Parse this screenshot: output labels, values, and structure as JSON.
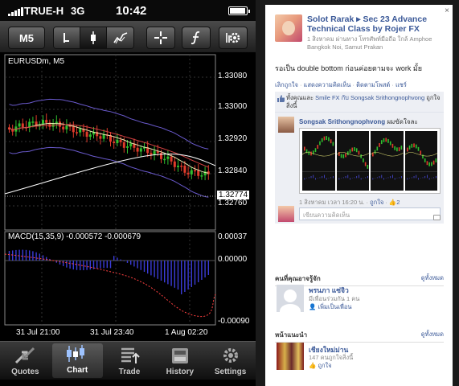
{
  "status_bar": {
    "carrier": "TRUE-H",
    "network": "3G",
    "time": "10:42"
  },
  "toolbar": {
    "timeframe": "M5",
    "buttons": [
      "line-chart",
      "candle-chart",
      "bar-chart",
      "crosshair",
      "indicators",
      "settings"
    ]
  },
  "chart": {
    "symbol_label": "EURUSDm, M5",
    "price_ticks": [
      "1.33080",
      "1.33000",
      "1.32920",
      "1.32840",
      "1.32760"
    ],
    "current_price": "1.32774",
    "macd_label": "MACD(15,35,9) -0.000572 -0.000679",
    "macd_ticks": [
      "0.00037",
      "0.00000",
      "-0.00090"
    ],
    "time_labels": [
      "31 Jul 21:00",
      "31 Jul 23:40",
      "1 Aug 02:20"
    ],
    "colors": {
      "bull": "#2fbf2f",
      "bear": "#e03b2b",
      "bollinger": "#6a5acd",
      "ma_fast": "#e8e8b0",
      "ma_mid": "#d04040",
      "ma_slow": "#ffffff"
    }
  },
  "tabbar": {
    "tabs": [
      "Quotes",
      "Chart",
      "Trade",
      "History",
      "Settings"
    ],
    "active": "Chart"
  },
  "facebook": {
    "close": "×",
    "post": {
      "title": "Solot Rarak ▸ Sec 23 Advance Technical Class by Rojer FX",
      "meta": "1 สิงหาคม ผ่านทาง โทรศัพท์มือถือ ใกล้ Amphoe Bangkok Noi, Samut Prakan",
      "body": "รอเป็น double bottom ก่อนค่อยตามจะ work มั้ย",
      "actions": [
        "เลิกถูกใจ",
        "แสดงความคิดเห็น",
        "ติดตามโพสต์",
        "แชร์"
      ]
    },
    "likes": {
      "prefix": "ทั้งคุณและ",
      "names": "Smile FX กับ Songsak Srithongnophvong",
      "suffix": "ถูกใจสิ่งนี้"
    },
    "comment": {
      "author": "Songsak Srithongnophvong",
      "text": "ผมขัดใจละ",
      "time": "1 สิงหาคม เวลา 16:20 น.",
      "like": "ถูกใจ",
      "like_count": "2"
    },
    "reply_placeholder": "เขียนความคิดเห็น",
    "people": {
      "heading": "คนที่คุณอาจรู้จัก",
      "see_all": "ดูทั้งหมด",
      "name": "พรนภา แซ่จิว",
      "mutual": "มีเพื่อนร่วมกัน 1 คน",
      "action": "เพิ่มเป็นเพื่อน"
    },
    "pages": {
      "heading": "หน้าแนะนำ",
      "see_all": "ดูทั้งหมด",
      "name": "เชียงใหม่ม่าน",
      "likes": "147 คนถูกใจสิ่งนี้",
      "action": "ถูกใจ"
    }
  }
}
